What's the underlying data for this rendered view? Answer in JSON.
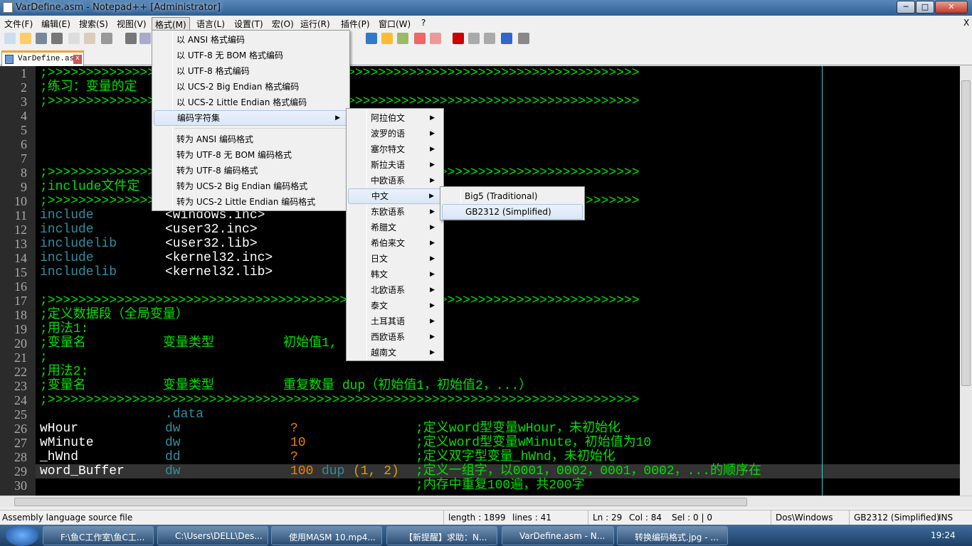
{
  "window": {
    "title": "VarDefine.asm - Notepad++ [Administrator]",
    "min": "─",
    "max": "□",
    "close": "✕"
  },
  "menubar": [
    "文件(F)",
    "编辑(E)",
    "搜索(S)",
    "视图(V)",
    "格式(M)",
    "语言(L)",
    "设置(T)",
    "宏(O)",
    "运行(R)",
    "插件(P)",
    "窗口(W)",
    "?"
  ],
  "menubar_close": "X",
  "tab": {
    "label": "VarDefine.asm",
    "close": "x"
  },
  "format_menu": [
    {
      "label": "以 ANSI 格式编码"
    },
    {
      "label": "以 UTF-8 无 BOM 格式编码"
    },
    {
      "label": "以 UTF-8 格式编码"
    },
    {
      "label": "以 UCS-2 Big Endian 格式编码"
    },
    {
      "label": "以 UCS-2 Little Endian 格式编码"
    },
    {
      "label": "编码字符集",
      "submenu": true,
      "highlighted": true
    },
    {
      "label": "转为 ANSI 编码格式"
    },
    {
      "label": "转为 UTF-8 无 BOM 编码格式"
    },
    {
      "label": "转为 UTF-8 编码格式"
    },
    {
      "label": "转为 UCS-2 Big Endian 编码格式"
    },
    {
      "label": "转为 UCS-2 Little Endian 编码格式"
    }
  ],
  "charset_menu": [
    "阿拉伯文",
    "波罗的语",
    "塞尔特文",
    "斯拉夫语",
    "中欧语系",
    "中文",
    "东欧语系",
    "希腊文",
    "希伯来文",
    "日文",
    "韩文",
    "北欧语系",
    "泰文",
    "土耳其语",
    "西欧语系",
    "越南文"
  ],
  "charset_highlighted": "中文",
  "chinese_menu": [
    "Big5 (Traditional)",
    "GB2312 (Simplified)"
  ],
  "chinese_highlighted": "GB2312 (Simplified)",
  "code": [
    [
      [
        ";>>>>>>>>>>>>>>>>>>>>>>>>>>>>>>>>>>>>>>>>>>>>>>>>>>>>>>>>>>>>>>>>>>>>>>>>>>>>>",
        "cm",
        0
      ]
    ],
    [
      [
        ";练习：变量的定",
        "cm",
        0
      ]
    ],
    [
      [
        ";>>>>>>>>>>>>>>>>>>>>>>>>>>>>>>>>>>>>>>>>>>>>>>>>>>>>>>>>>>>>>>>>>>>>>>>>>>>>>",
        "cm",
        0
      ]
    ],
    [],
    [],
    [],
    [],
    [
      [
        ";>>>>>>>>>>>>>>>>>>>>>>>>>>>>>>>>>>>>>>>>>>>>>>>>>>>>>>>>>>>>>>>>>>>>>>>>>>>>>",
        "cm",
        0
      ]
    ],
    [
      [
        ";include文件定",
        "cm",
        0
      ]
    ],
    [
      [
        ";>>>>>>>>>>>>>>>>>>>>>>>>>>>>>>>>>>>>>>>>>>>>>>>>>>>>>>>>>>>>>>>>>>>>>>>>>>>>>",
        "cm",
        0
      ]
    ],
    [
      [
        "include",
        "kw",
        0
      ],
      [
        "<windows.inc>",
        "id",
        16
      ]
    ],
    [
      [
        "include",
        "kw",
        0
      ],
      [
        "<user32.inc>",
        "id",
        16
      ]
    ],
    [
      [
        "includelib",
        "kw",
        0
      ],
      [
        "<user32.lib>",
        "id",
        16
      ]
    ],
    [
      [
        "include",
        "kw",
        0
      ],
      [
        "<kernel32.inc>",
        "id",
        16
      ]
    ],
    [
      [
        "includelib",
        "kw",
        0
      ],
      [
        "<kernel32.lib>",
        "id",
        16
      ]
    ],
    [],
    [
      [
        ";>>>>>>>>>>>>>>>>>>>>>>>>>>>>>>>>>>>>>>>>>>>>>>>>>>>>>>>>>>>>>>>>>>>>>>>>>>>>>",
        "cm",
        0
      ]
    ],
    [
      [
        ";定义数据段（全局变量）",
        "cm",
        0
      ]
    ],
    [
      [
        ";用法1:",
        "cm",
        0
      ]
    ],
    [
      [
        ";变量名          变量类型         初始值1,",
        "cm",
        0
      ]
    ],
    [
      [
        ";",
        "cm",
        0
      ]
    ],
    [
      [
        ";用法2:",
        "cm",
        0
      ]
    ],
    [
      [
        ";变量名          变量类型         重复数量 dup（初始值1，初始值2，...）",
        "cm",
        0
      ]
    ],
    [
      [
        ";>>>>>>>>>>>>>>>>>>>>>>>>>>>>>>>>>>>>>>>>>>>>>>>>>>>>>>>>>>>>>>>>>>>>>>>>>>>>>",
        "cm",
        0
      ]
    ],
    [
      [
        ".data",
        "kw",
        16
      ]
    ],
    [
      [
        "wHour",
        "id",
        0
      ],
      [
        "dw",
        "kw",
        16
      ],
      [
        "?",
        "num",
        32
      ],
      [
        ";定义word型变量wHour，未初始化",
        "cm",
        48
      ]
    ],
    [
      [
        "wMinute",
        "id",
        0
      ],
      [
        "dw",
        "kw",
        16
      ],
      [
        "10",
        "num",
        32
      ],
      [
        ";定义word型变量wMinute，初始值为10",
        "cm",
        48
      ]
    ],
    [
      [
        "_hWnd",
        "id",
        0
      ],
      [
        "dd",
        "kw",
        16
      ],
      [
        "?",
        "num",
        32
      ],
      [
        ";定义双字型变量_hWnd，未初始化",
        "cm",
        48
      ]
    ],
    [
      [
        "word_Buffer",
        "id",
        0
      ],
      [
        "dw",
        "kw",
        16
      ],
      [
        "100",
        "num",
        32
      ],
      [
        "dup",
        "kw",
        36
      ],
      [
        "(1, 2)",
        "par",
        40
      ],
      [
        ";定义一组字，以0001，0002，0001，0002，...的顺序在",
        "cm",
        48
      ]
    ],
    [
      [
        ";内存中重复100遍，共200字",
        "cm",
        48
      ]
    ]
  ],
  "status": {
    "type": "Assembly language source file",
    "length": "length : 1899",
    "lines": "lines : 41",
    "ln": "Ln : 29",
    "col": "Col : 84",
    "sel": "Sel : 0 | 0",
    "eol": "Dos\\Windows",
    "encoding": "GB2312 (Simplified)",
    "mode": "INS"
  },
  "taskbar": {
    "items": [
      "F:\\鱼C工作室\\鱼C工...",
      "C:\\Users\\DELL\\Des...",
      "使用MASM 10.mp4...",
      "【新提醒】求助：N...",
      "VarDefine.asm - N...",
      "转换编码格式.jpg - ..."
    ],
    "clock": "19:24"
  },
  "colors": {
    "editor_bg": "#000000",
    "comment": "#00e000",
    "keyword": "#2f8fa0",
    "number": "#f08000"
  }
}
